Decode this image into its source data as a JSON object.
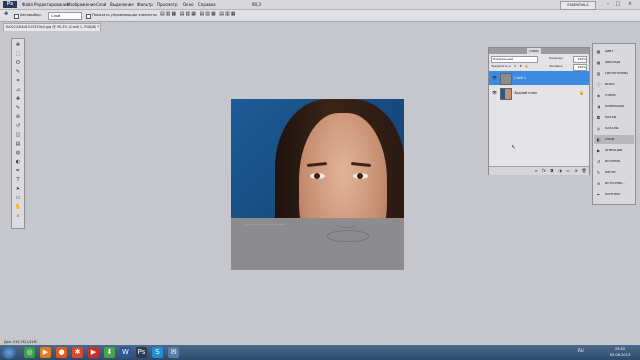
{
  "app": {
    "logo": "Ps",
    "menu": [
      "Файл",
      "Редактирование",
      "Изображение",
      "Слой",
      "Выделение",
      "Фильтр",
      "Просмотр",
      "Окно",
      "Справка"
    ],
    "zoom": "90,3",
    "workspace": "ESSENTIALS",
    "window_controls": [
      "–",
      "□",
      "×"
    ]
  },
  "options": {
    "autoselect_label": "Автовыбор:",
    "autoselect_value": "Слой",
    "show_controls_label": "Показать управляющие элементы"
  },
  "document": {
    "tab_title": "fb02224f4d1513333e3.jpg @ 90,3% (Слой 1, RGB/8) *"
  },
  "toolbox": {
    "tools": [
      "move-icon",
      "marquee-icon",
      "lasso-icon",
      "quick-select-icon",
      "crop-icon",
      "eyedropper-icon",
      "healing-icon",
      "brush-icon",
      "stamp-icon",
      "history-brush-icon",
      "eraser-icon",
      "gradient-icon",
      "blur-icon",
      "dodge-icon",
      "pen-icon",
      "type-icon",
      "path-select-icon",
      "shape-icon",
      "hand-icon",
      "zoom-icon"
    ],
    "glyphs": [
      "✥",
      "⬚",
      "ʘ",
      "✎",
      "⌗",
      "⊿",
      "✚",
      "✎",
      "⊛",
      "↺",
      "◫",
      "▤",
      "◍",
      "◐",
      "✒",
      "T",
      "➤",
      "▭",
      "✋",
      "⌕"
    ]
  },
  "layers_panel": {
    "tab_label": "СЛОИ",
    "blend_mode": "Нормальный",
    "opacity_label": "Непрозр.:",
    "opacity_value": "100%",
    "lock_label": "Закрепить:",
    "fill_label": "Заливка:",
    "fill_value": "100%",
    "layers": [
      {
        "name": "Слой 1",
        "selected": true
      },
      {
        "name": "Задний план",
        "selected": false,
        "locked": true
      }
    ],
    "footer_icons": [
      "link-icon",
      "fx-icon",
      "mask-icon",
      "adjustment-icon",
      "folder-icon",
      "new-layer-icon",
      "trash-icon"
    ],
    "footer_glyphs": [
      "∞",
      "fx",
      "◘",
      "◑",
      "▭",
      "⊕",
      "🗑"
    ]
  },
  "dock": {
    "items": [
      {
        "label": "ЦВЕТ",
        "icon": "▦"
      },
      {
        "label": "ОБРАЗЦЫ",
        "icon": "▦"
      },
      {
        "label": "ГИСТОГРАММА",
        "icon": "▥"
      },
      {
        "label": "ИНФО",
        "icon": "ⓘ"
      },
      {
        "label": "СТИЛИ",
        "icon": "◈"
      },
      {
        "label": "КОРРЕКЦИЯ",
        "icon": "◑"
      },
      {
        "label": "МАСКИ",
        "icon": "◘"
      },
      {
        "label": "КАНАЛЫ",
        "icon": "◎"
      },
      {
        "label": "СЛОИ",
        "icon": "◧"
      },
      {
        "label": "ОПЕРАЦИИ",
        "icon": "▶"
      },
      {
        "label": "ИСТОРИЯ",
        "icon": "↺"
      },
      {
        "label": "КИСТИ",
        "icon": "✎"
      },
      {
        "label": "ИСТОЧНИК...",
        "icon": "⊛"
      },
      {
        "label": "КОНТУРЫ",
        "icon": "✒"
      }
    ],
    "active": "СЛОИ"
  },
  "status": {
    "text": "Док: 510,7K/1,61M"
  },
  "taskbar": {
    "icons": [
      "◎",
      "▶",
      "●",
      "✱",
      "▶",
      "⬇",
      "W",
      "Ps",
      "S",
      "✉"
    ],
    "icon_names": [
      "chrome-icon",
      "media-player-icon",
      "firefox-icon",
      "app-icon",
      "youtube-icon",
      "utorrent-icon",
      "word-icon",
      "photoshop-icon",
      "skype-icon",
      "mail-icon"
    ],
    "icon_colors": [
      "#3c9e4a",
      "#e07b1f",
      "#e05a1f",
      "#d84a2e",
      "#c9302c",
      "#4aa34a",
      "#2b5797",
      "#2b3a55",
      "#1f8fd6",
      "#5a7ca8"
    ],
    "language": "RU",
    "time": "23:02",
    "date": "05.08.2013"
  }
}
